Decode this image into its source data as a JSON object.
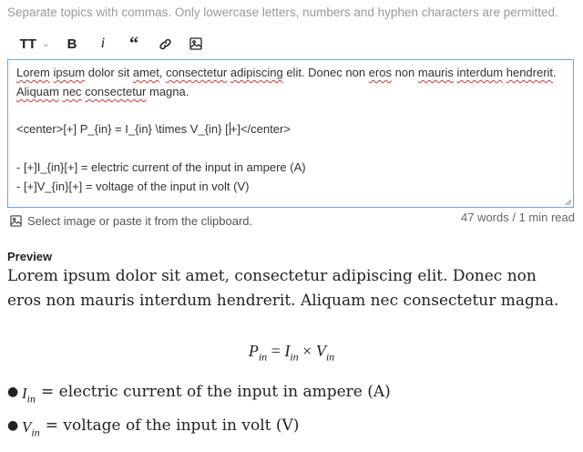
{
  "hint": "Separate topics with commas. Only lowercase letters, numbers and hyphen characters are permitted.",
  "toolbar": {
    "heading": "TT",
    "heading_chevron": "⌄",
    "bold": "B",
    "italic": "i",
    "quote": "“"
  },
  "editor": {
    "line1": [
      "Lorem",
      " ",
      "ipsum",
      " dolor sit ",
      "amet",
      ", ",
      "consectetur",
      " ",
      "adipiscing",
      " elit. Donec non ",
      "eros",
      " non ",
      "mauris",
      " ",
      "interdum",
      " ",
      "hendrerit",
      "."
    ],
    "line2": [
      "Aliquam",
      " ",
      "nec",
      " ",
      "consectetur",
      " magna."
    ],
    "line3_before_caret": "<center>[+] P_{in} = I_{in} \\times V_{in} [",
    "line3_after_caret": "+]</center>",
    "line4": "- [+]I_{in}[+] = electric current of the input in ampere (A)",
    "line5": "- [+]V_{in}[+] = voltage of the input in volt (V)"
  },
  "upload_text": "Select image or paste it from the clipboard.",
  "word_count": "47 words / 1 min read",
  "preview": {
    "label": "Preview",
    "paragraph": "Lorem ipsum dolor sit amet, consectetur adipiscing elit. Donec non eros non mauris interdum hendrerit. Aliquam nec consectetur magna.",
    "equation": {
      "p": "P",
      "p_sub": "in",
      "eq": "=",
      "i": "I",
      "i_sub": "in",
      "times": "×",
      "v": "V",
      "v_sub": "in"
    },
    "bullets": [
      {
        "var": "I",
        "sub": "in",
        "text": "= electric current of the input in ampere (A)"
      },
      {
        "var": "V",
        "sub": "in",
        "text": "= voltage of the input in volt (V)"
      }
    ]
  }
}
